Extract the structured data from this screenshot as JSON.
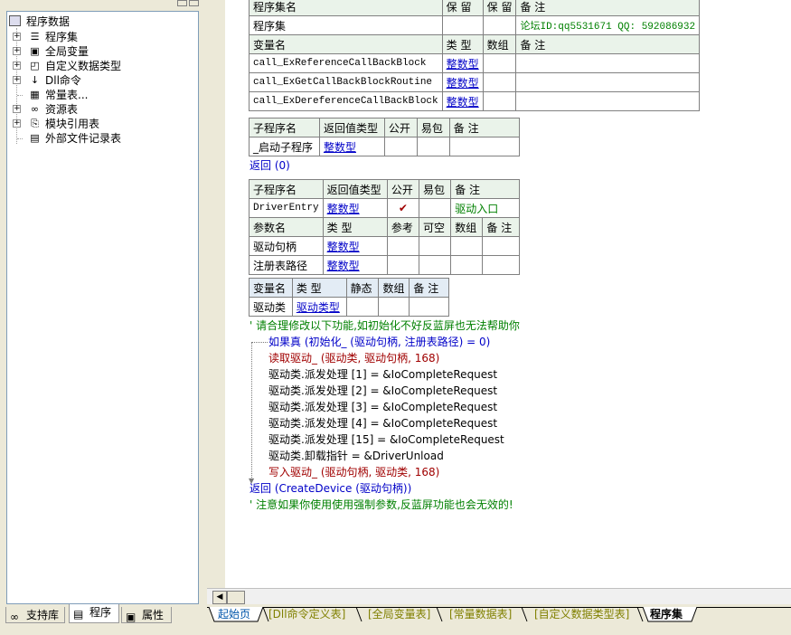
{
  "tree": {
    "root": "程序数据",
    "items": [
      {
        "label": "程序集",
        "icon": "stack-icon",
        "expander": true,
        "selected": true
      },
      {
        "label": "全局变量",
        "icon": "jar-icon",
        "expander": true
      },
      {
        "label": "自定义数据类型",
        "icon": "shapes-icon",
        "expander": true
      },
      {
        "label": "Dll命令",
        "icon": "dll-icon",
        "expander": true
      },
      {
        "label": "常量表...",
        "icon": "constant-icon",
        "expander": false
      },
      {
        "label": "资源表",
        "icon": "resource-icon",
        "expander": true
      },
      {
        "label": "模块引用表",
        "icon": "module-icon",
        "expander": true
      },
      {
        "label": "外部文件记录表",
        "icon": "file-list-icon",
        "expander": false
      }
    ]
  },
  "left_tabs": [
    {
      "label": "支持库",
      "icon": "library-icon",
      "active": false
    },
    {
      "label": "程序",
      "icon": "program-icon",
      "active": true
    },
    {
      "label": "属性",
      "icon": "property-icon",
      "active": false
    }
  ],
  "assembly_table": {
    "h1": [
      "程序集名",
      "保 留",
      "保 留",
      "备 注"
    ],
    "row": [
      "程序集",
      "",
      "",
      "论坛ID:qq5531671 QQ: 592086932"
    ],
    "h2": [
      "变量名",
      "类 型",
      "数组",
      "备 注"
    ],
    "vars": [
      [
        "call_ExReferenceCallBackBlock",
        "整数型",
        "",
        ""
      ],
      [
        "call_ExGetCallBackBlockRoutine",
        "整数型",
        "",
        ""
      ],
      [
        "call_ExDereferenceCallBackBlock",
        "整数型",
        "",
        ""
      ]
    ]
  },
  "sub1": {
    "header": [
      "子程序名",
      "返回值类型",
      "公开",
      "易包",
      "备 注"
    ],
    "row": [
      "_启动子程序",
      "整数型",
      "",
      "",
      ""
    ],
    "return_line": "返回 (0)"
  },
  "sub2": {
    "header": [
      "子程序名",
      "返回值类型",
      "公开",
      "易包",
      "备 注"
    ],
    "row": [
      "DriverEntry",
      "整数型",
      "✔",
      "",
      "驱动入口"
    ],
    "param_header": [
      "参数名",
      "类 型",
      "参考",
      "可空",
      "数组",
      "备 注"
    ],
    "params": [
      [
        "驱动句柄",
        "整数型",
        "",
        "",
        "",
        ""
      ],
      [
        "注册表路径",
        "整数型",
        "",
        "",
        "",
        ""
      ]
    ]
  },
  "locals": {
    "header": [
      "变量名",
      "类 型",
      "静态",
      "数组",
      "备 注"
    ],
    "row": [
      "驱动类",
      "驱动类型",
      "",
      "",
      ""
    ]
  },
  "code": {
    "comment1": "' 请合理修改以下功能,如初始化不好反蓝屏也无法帮助你",
    "if_line": "如果真 (初始化_ (驱动句柄, 注册表路径) = 0)",
    "read_line": "读取驱动_ (驱动类, 驱动句柄, 168)",
    "dispatch": [
      "驱动类.派发处理 [1] = &IoCompleteRequest",
      "驱动类.派发处理 [2] = &IoCompleteRequest",
      "驱动类.派发处理 [3] = &IoCompleteRequest",
      "驱动类.派发处理 [4] = &IoCompleteRequest",
      "驱动类.派发处理 [15] = &IoCompleteRequest"
    ],
    "unload_line": "驱动类.卸载指针 = &DriverUnload",
    "write_line": "写入驱动_ (驱动句柄, 驱动类, 168)",
    "return_line": "返回 (CreateDevice (驱动句柄))",
    "comment2": "' 注意如果你使用使用强制参数,反蓝屏功能也会无效的!"
  },
  "bottom_tabs": [
    "起始页",
    "[Dll命令定义表]",
    "[全局变量表]",
    "[常量数据表]",
    "[自定义数据类型表]",
    "程序集"
  ]
}
